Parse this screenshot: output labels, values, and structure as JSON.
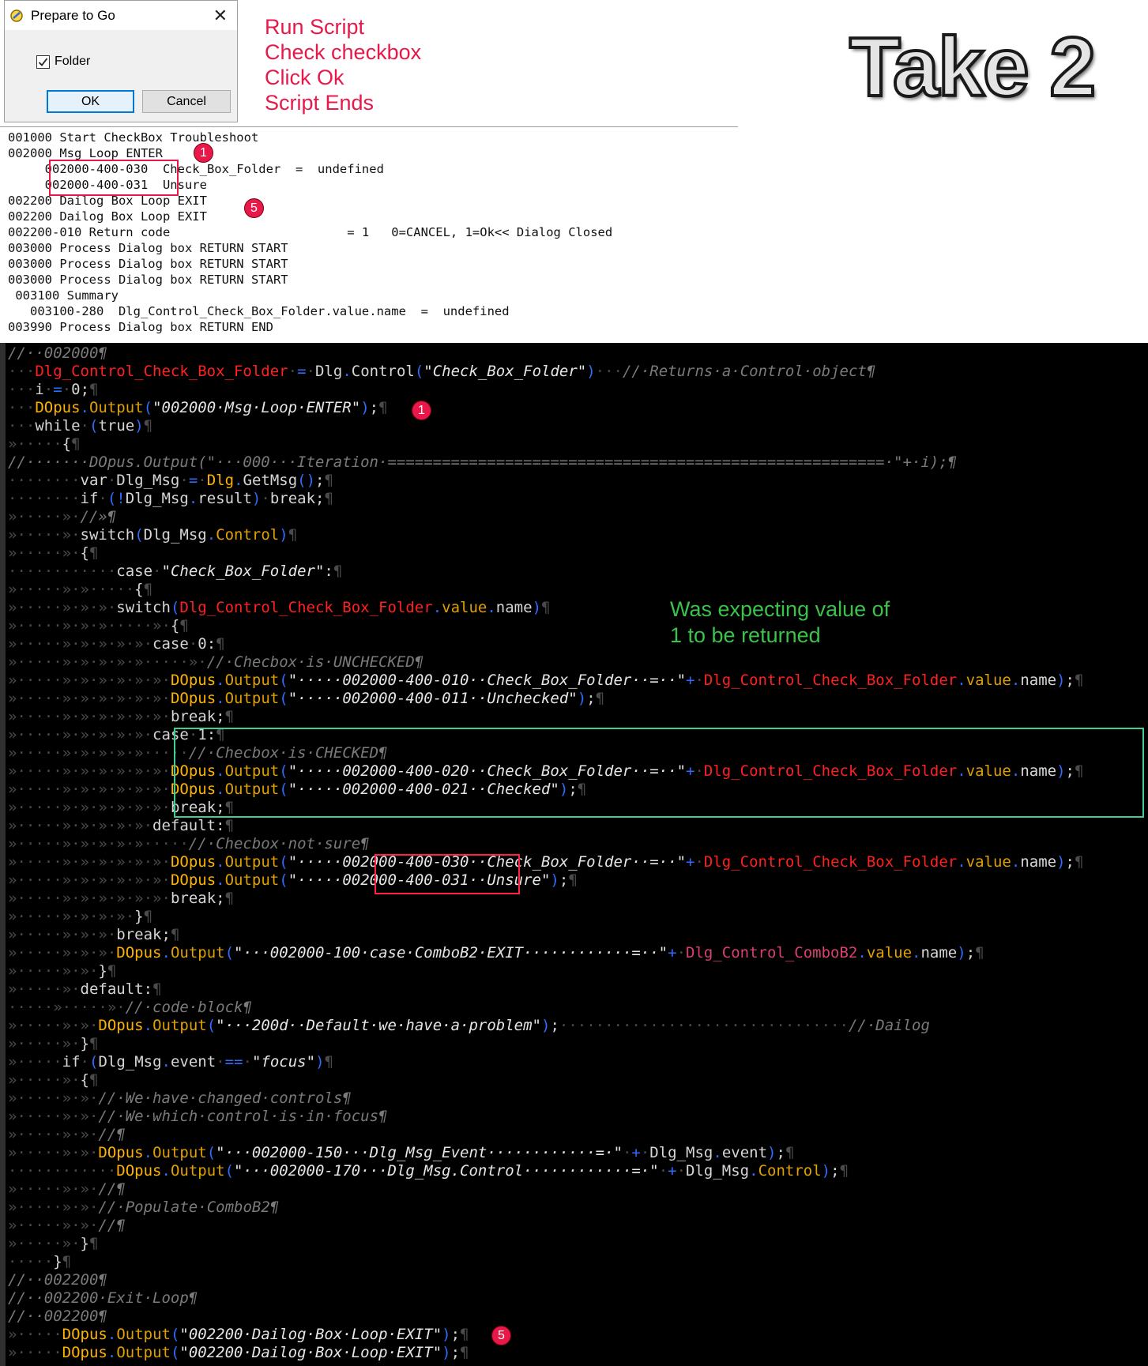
{
  "dialog": {
    "title": "Prepare to Go",
    "checkbox_label": "Folder",
    "checkbox_checked": true,
    "ok_label": "OK",
    "cancel_label": "Cancel",
    "close_glyph": "✕"
  },
  "steps": [
    "Run Script",
    "Check checkbox",
    "Click Ok",
    "Script Ends"
  ],
  "take_label": "Take 2",
  "badges": {
    "first": "1",
    "second": "5"
  },
  "log_text": "001000 Start CheckBox Troubleshoot\n002000 Msg Loop ENTER\n     002000-400-030  Check_Box_Folder  =  undefined\n     002000-400-031  Unsure\n002200 Dailog Box Loop EXIT\n002200 Dailog Box Loop EXIT\n002200-010 Return code                        = 1   0=CANCEL, 1=Ok<< Dialog Closed\n003000 Process Dialog box RETURN START\n003000 Process Dialog box RETURN START\n003000 Process Dialog box RETURN START\n 003100 Summary\n   003100-280  Dlg_Control_Check_Box_Folder.value.name  =  undefined\n003990 Process Dialog box RETURN END",
  "note": "Was expecting value of\n1 to be returned",
  "colors": {
    "annotation_red": "#e8194a",
    "annotation_green": "#3bc24a",
    "case_box": "#3fcf8e",
    "code_red": "#ff2020",
    "code_yellow": "#ffb300",
    "code_blue": "#2e6cff"
  },
  "icons": {
    "app": "dialog-app-icon",
    "close": "close-icon",
    "check": "checkmark-icon"
  }
}
